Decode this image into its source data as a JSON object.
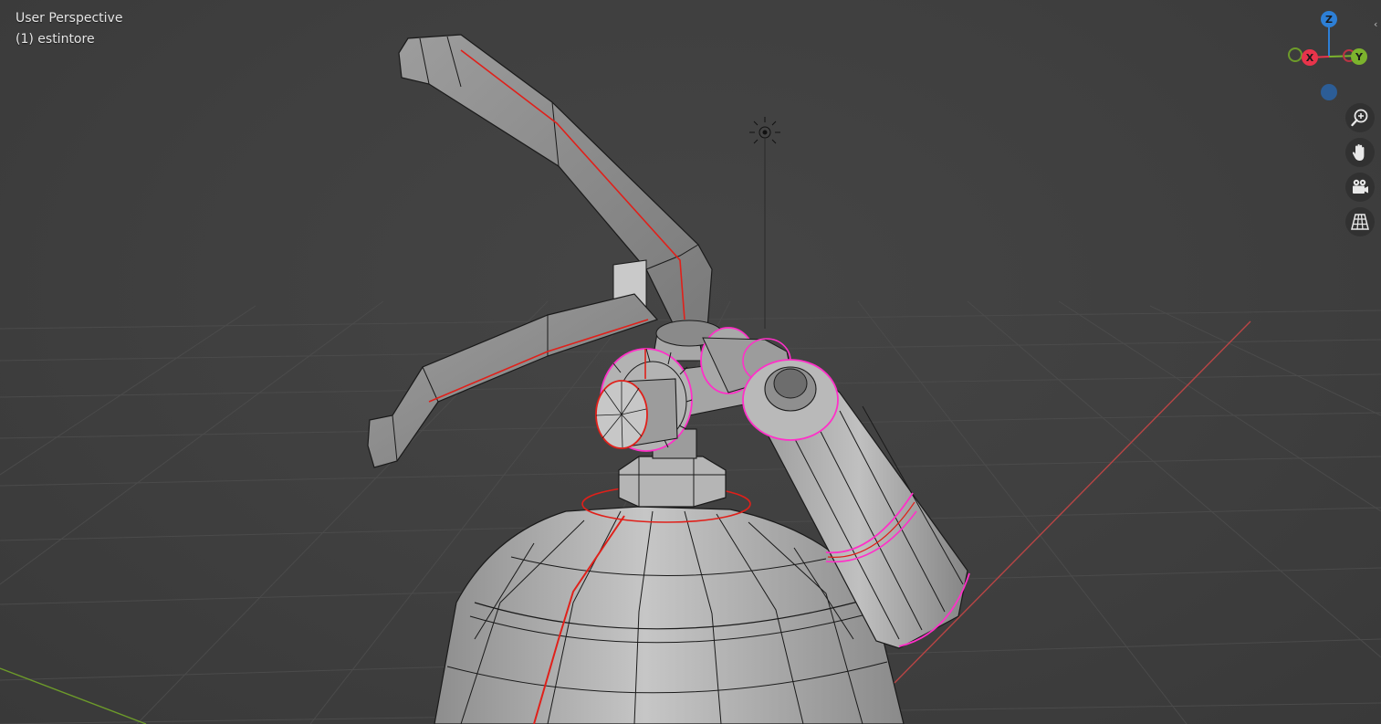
{
  "viewport": {
    "view_name": "User Perspective",
    "object_name": "(1) estintore"
  },
  "gizmo": {
    "axes": [
      {
        "key": "z",
        "label": "Z",
        "color": "#2d7fd6"
      },
      {
        "key": "x",
        "label": "X",
        "color": "#e8344b"
      },
      {
        "key": "y",
        "label": "Y",
        "color": "#7cb32d"
      }
    ],
    "neg_axis_colors": {
      "x": "#b93444",
      "y": "#6d9b2a",
      "z": "#2c5d96"
    }
  },
  "nav_buttons": [
    {
      "key": "zoom",
      "icon": "zoom-icon"
    },
    {
      "key": "pan",
      "icon": "hand-icon"
    },
    {
      "key": "camera",
      "icon": "camera-icon"
    },
    {
      "key": "ortho",
      "icon": "grid-icon"
    }
  ],
  "colors": {
    "background": "#3d3d3d",
    "grid": "#4a4a4a",
    "x_axis_line": "#b84545",
    "y_axis_line": "#6d9b2a",
    "mesh_fill": "#a9a9a9",
    "mesh_edge": "#1a1a1a",
    "seam": "#e0201a",
    "selected_edge": "#ff30c8"
  }
}
